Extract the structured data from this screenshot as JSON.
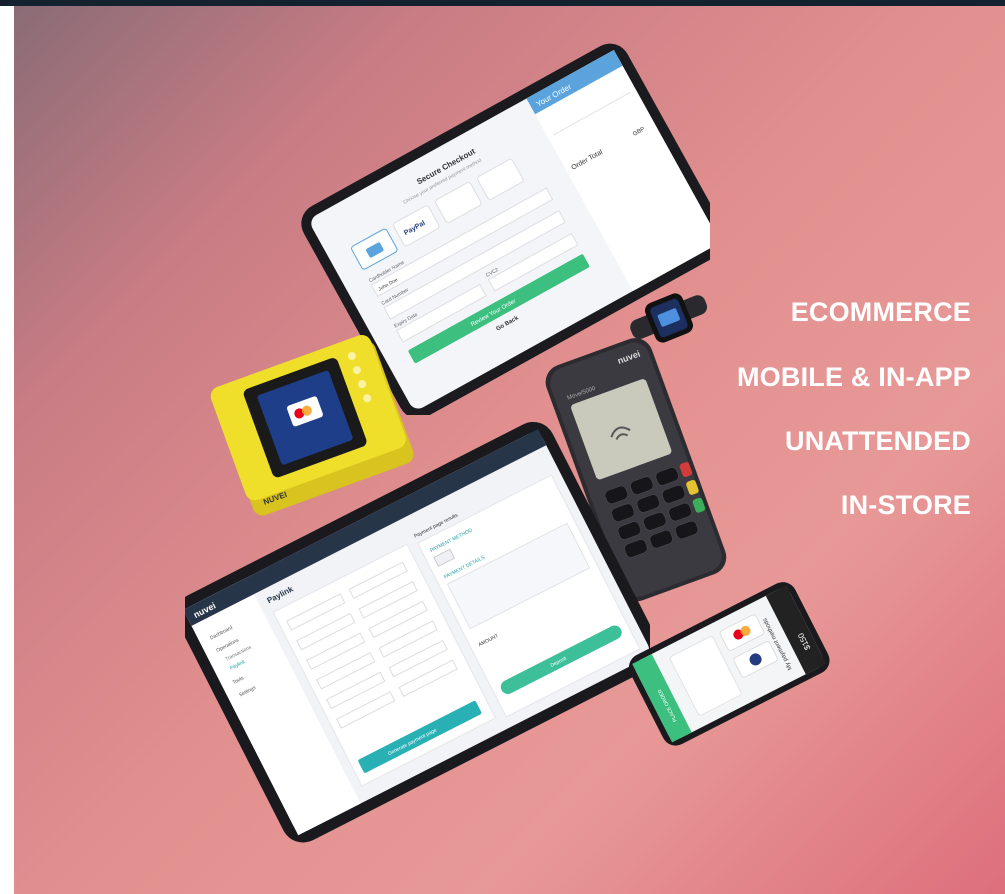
{
  "taglines": [
    "ECOMMERCE",
    "MOBILE & IN-APP",
    "UNATTENDED",
    "IN-STORE"
  ],
  "checkout_tablet": {
    "title": "Secure Checkout",
    "subtitle": "Choose your preferred payment method",
    "order_header": "Your Order",
    "order_total": "Order Total",
    "currency": "GBP",
    "pay_button": "Review Your Order",
    "go_back": "Go Back",
    "field_cardholder": "Cardholder Name",
    "cardholder_value": "John Doe",
    "field_card": "Card Number",
    "field_expiry": "Expiry Date",
    "field_cvc": "CVC2",
    "wallet_label": "PayPal"
  },
  "unattended_terminal": {
    "brand": "NUVEI"
  },
  "pos_terminal": {
    "brand": "nuvei",
    "model": "Move/5000"
  },
  "paylink_tablet": {
    "logo": "nuvei",
    "title": "Paylink",
    "nav": [
      "Dashboard",
      "Operations",
      "Transactions",
      "Paylink",
      "Tools",
      "Settings"
    ],
    "right_header": "Payment page results",
    "methods_label": "PAYMENT METHOD",
    "details_label": "PAYMENT DETAILS",
    "amount_label": "AMOUNT",
    "button": "Generate payment page",
    "deposit": "Deposit"
  },
  "phone": {
    "amount": "$150",
    "title": "My payment methods",
    "button": "PLACE ORDER"
  },
  "colors": {
    "accent_green": "#3dbf7f",
    "brand_blue": "#5ba3dd",
    "terminal_yellow": "#f0df2a"
  }
}
